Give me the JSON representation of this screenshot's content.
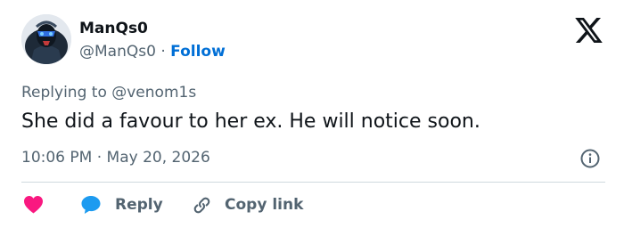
{
  "author": {
    "display_name": "ManQs0",
    "handle": "@ManQs0",
    "separator": "·",
    "follow_label": "Follow",
    "avatar_icon": "masked-figure-avatar"
  },
  "platform_icon": "x-logo-icon",
  "reply_context": "Replying to @venom1s",
  "text": "She did a favour to her ex. He will notice soon.",
  "timestamp": "10:06 PM · May 20, 2026",
  "actions": {
    "like_icon": "heart-icon",
    "reply_label": "Reply",
    "copy_link_label": "Copy link"
  },
  "colors": {
    "link_blue": "#006fd6",
    "heart_red": "#f91880",
    "reply_blue": "#1d9bf0",
    "muted_text": "#536471",
    "divider": "#cfd9de"
  }
}
